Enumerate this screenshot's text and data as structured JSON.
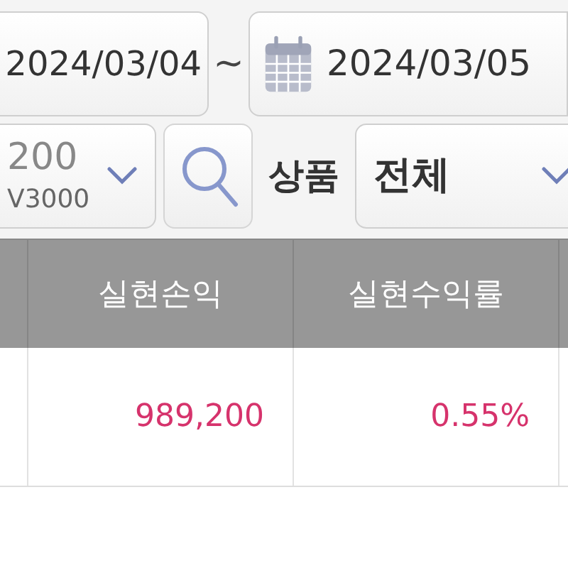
{
  "date_range": {
    "start": "2024/03/04",
    "separator": "~",
    "end": "2024/03/05"
  },
  "filters": {
    "account": {
      "value": "200",
      "sub": "V3000"
    },
    "product": {
      "label": "상품",
      "value": "전체"
    }
  },
  "table": {
    "columns": [
      "실현손익",
      "실현수익률"
    ],
    "rows": [
      {
        "cells": [
          "989,200",
          "0.55%"
        ]
      }
    ]
  }
}
